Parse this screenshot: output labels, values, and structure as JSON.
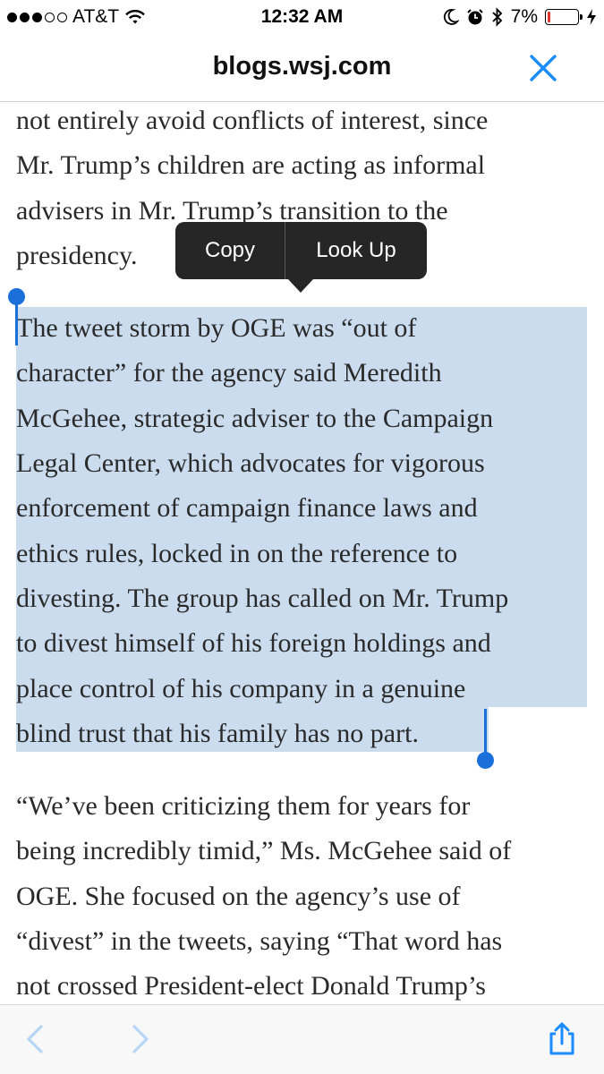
{
  "status_bar": {
    "carrier": "AT&T",
    "time": "12:32 AM",
    "battery_percent_label": "7%",
    "battery_level": 0.07,
    "signal_bars": 3,
    "signal_total": 5,
    "icons": [
      "wifi-icon",
      "moon-icon",
      "alarm-icon",
      "bluetooth-icon",
      "battery-icon",
      "charging-bolt-icon"
    ]
  },
  "nav": {
    "title": "blogs.wsj.com",
    "close_icon": "close-icon",
    "accent": "#1a8cff"
  },
  "article": {
    "para1_lines": [
      "not entirely avoid conflicts of interest, since",
      "Mr. Trump’s children are acting as informal",
      "advisers in Mr. Trump’s transition to the",
      "presidency."
    ],
    "para2_lines": [
      "The tweet storm by OGE was “out of",
      "character” for the agency said Meredith",
      "McGehee, strategic adviser to the Campaign",
      "Legal Center, which advocates for vigorous",
      "enforcement of campaign finance laws and",
      "ethics rules, locked in on the reference to",
      "divesting. The group has called on Mr. Trump",
      "to divest himself of his foreign holdings and",
      "place control of his company in a genuine",
      "blind trust that his family has no part."
    ],
    "para3_lines": [
      "“We’ve been criticizing them for years for",
      "being incredibly timid,” Ms. McGehee said of",
      "OGE. She focused on the agency’s use of",
      "“divest” in the tweets, saying “That word has",
      "not crossed President-elect Donald Trump’s"
    ],
    "selection_color": "#cadcee",
    "handle_color": "#1a6fd9"
  },
  "edit_menu": {
    "copy_label": "Copy",
    "lookup_label": "Look Up"
  },
  "toolbar": {
    "back_icon": "back-chevron-icon",
    "forward_icon": "forward-chevron-icon",
    "share_icon": "share-icon",
    "inactive_color": "#b5d6f5",
    "active_color": "#1a8cff"
  }
}
